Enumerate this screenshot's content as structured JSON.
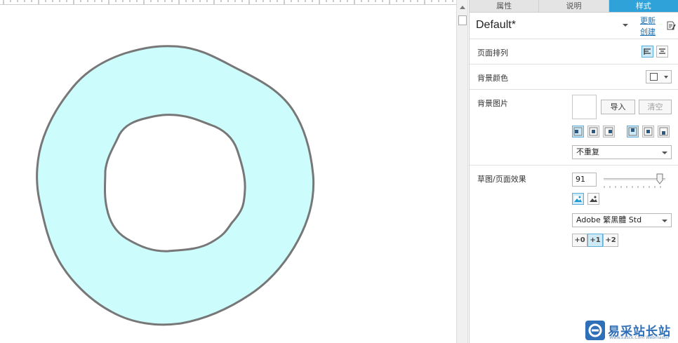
{
  "tabs": [
    {
      "label": "属性",
      "active": false
    },
    {
      "label": "说明",
      "active": false
    },
    {
      "label": "样式",
      "active": true
    }
  ],
  "page": {
    "name": "Default*",
    "update_link": "更新",
    "create_link": "创建"
  },
  "rows": {
    "page_align": {
      "label": "页面排列"
    },
    "bg_color": {
      "label": "背景颜色",
      "value": "#ffffff"
    },
    "bg_image": {
      "label": "背景图片",
      "import_label": "导入",
      "clear_label": "清空",
      "repeat_value": "不重复"
    },
    "sketch": {
      "label": "草图/页面效果",
      "sketchiness": "91",
      "sketchiness_level": 91,
      "font_value": "Adobe 繁黑體 Std",
      "line_width_options": [
        "+0",
        "+1",
        "+2"
      ],
      "line_width_selected": "+1"
    }
  },
  "canvas": {
    "shape": "donut",
    "fill_color": "#ccfcfc",
    "stroke_color": "#777777"
  },
  "watermark": {
    "brand": "易采站长站",
    "sub": "Www.Easck.Com Webmaster"
  },
  "colors": {
    "accent": "#2ea2d9",
    "selected_bg": "#cfeaf7"
  }
}
